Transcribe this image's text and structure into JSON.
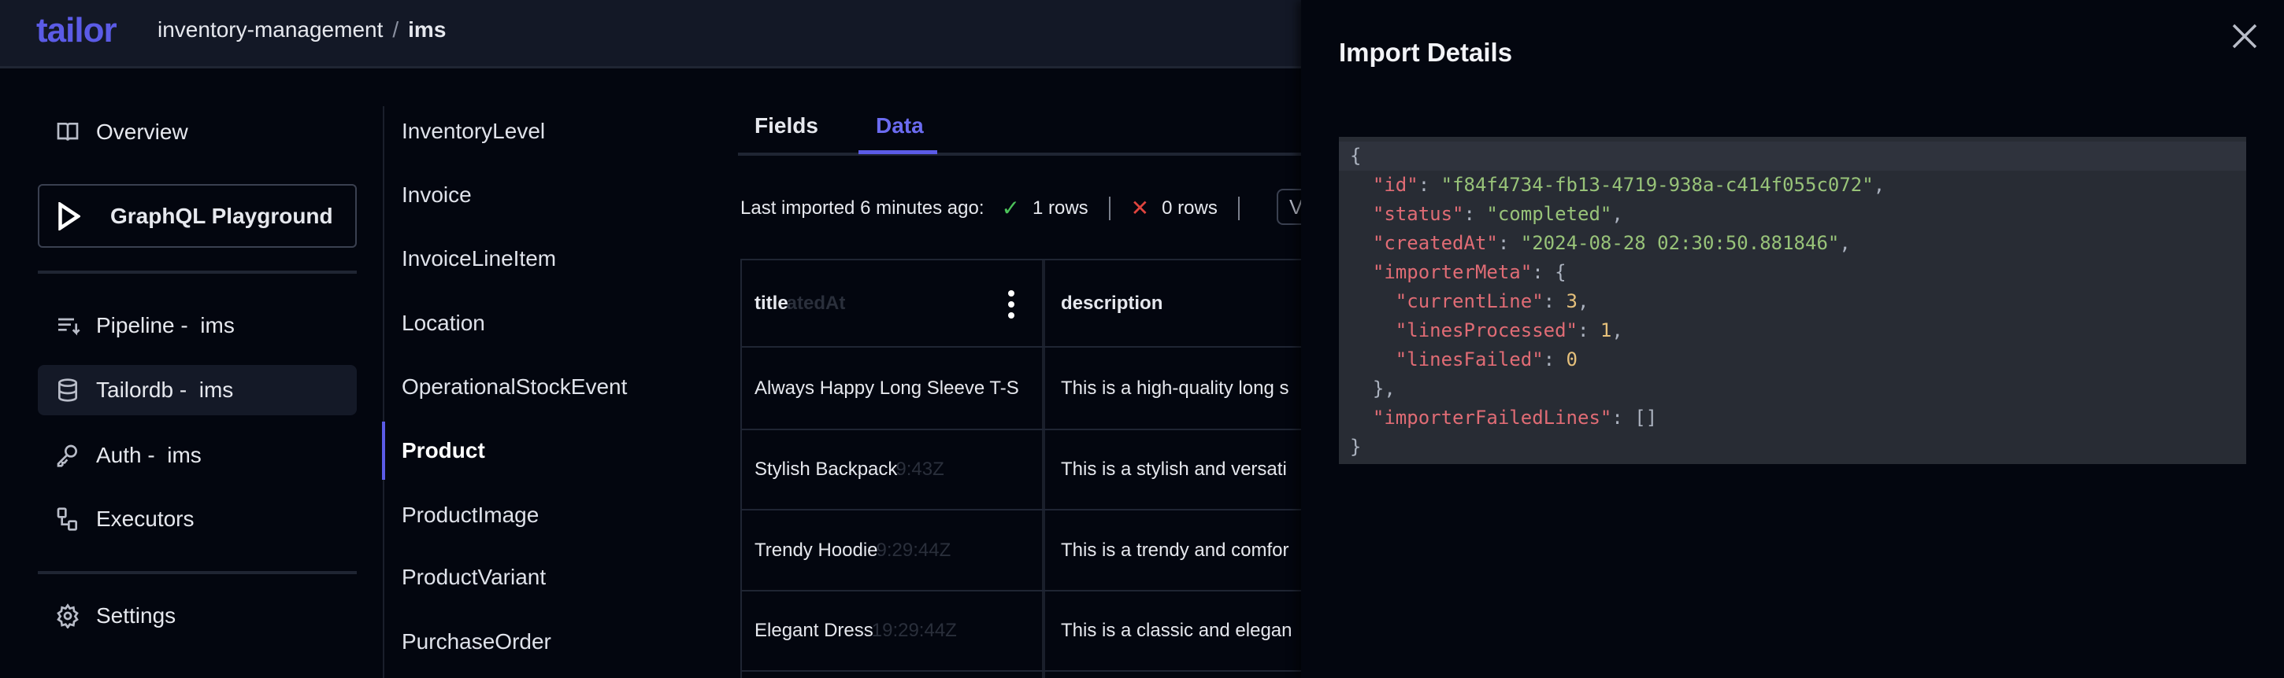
{
  "header": {
    "logo": "tailor",
    "breadcrumb": [
      "inventory-management",
      "ims"
    ],
    "separator": "/"
  },
  "colors": {
    "accent": "#5b5be6",
    "success": "#4cc35a",
    "error": "#e0443e"
  },
  "sidebar": {
    "overview": {
      "label": "Overview",
      "icon": "book-icon"
    },
    "graphql": {
      "label": "GraphQL Playground",
      "icon": "play-icon"
    },
    "items": [
      {
        "label": "Pipeline -  ims",
        "icon": "pipeline-icon"
      },
      {
        "label": "Tailordb -  ims",
        "icon": "database-icon",
        "active": true
      },
      {
        "label": "Auth -  ims",
        "icon": "key-icon"
      },
      {
        "label": "Executors",
        "icon": "executors-icon"
      }
    ],
    "settings": {
      "label": "Settings",
      "icon": "gear-icon"
    }
  },
  "types": [
    "InventoryLevel",
    "Invoice",
    "InvoiceLineItem",
    "Location",
    "OperationalStockEvent",
    "Product",
    "ProductImage",
    "ProductVariant",
    "PurchaseOrder"
  ],
  "selected_type": "Product",
  "tabs": [
    {
      "label": "Fields"
    },
    {
      "label": "Data",
      "active": true
    }
  ],
  "import_status": {
    "text": "Last imported 6 minutes ago:",
    "success": "1 rows",
    "failed": "0 rows",
    "button": "V"
  },
  "table": {
    "columns": [
      "title",
      "description"
    ],
    "header_ghost": "atedAt",
    "rows": [
      {
        "title": "Always Happy Long Sleeve T-S",
        "ghost": "",
        "description": "This is a high-quality long s"
      },
      {
        "title": "Stylish Backpack",
        "ghost": "9:43Z",
        "description": "This is a stylish and versati"
      },
      {
        "title": "Trendy Hoodie",
        "ghost": "9:29:44Z",
        "description": "This is a trendy and comfor"
      },
      {
        "title": "Elegant Dress",
        "ghost": "19:29:44Z",
        "description": "This is a classic and elegan"
      },
      {
        "title": "",
        "ghost": "",
        "description": ""
      }
    ]
  },
  "panel": {
    "title": "Import Details",
    "json": {
      "id": "f84f4734-fb13-4719-938a-c414f055c072",
      "status": "completed",
      "createdAt": "2024-08-28 02:30:50.881846",
      "currentLine": "3",
      "linesProcessed": "1",
      "linesFailed": "0",
      "importerFailedLines": "[]"
    },
    "keys": {
      "id": "\"id\"",
      "status": "\"status\"",
      "createdAt": "\"createdAt\"",
      "importerMeta": "\"importerMeta\"",
      "currentLine": "\"currentLine\"",
      "linesProcessed": "\"linesProcessed\"",
      "linesFailed": "\"linesFailed\"",
      "importerFailedLines": "\"importerFailedLines\""
    }
  }
}
